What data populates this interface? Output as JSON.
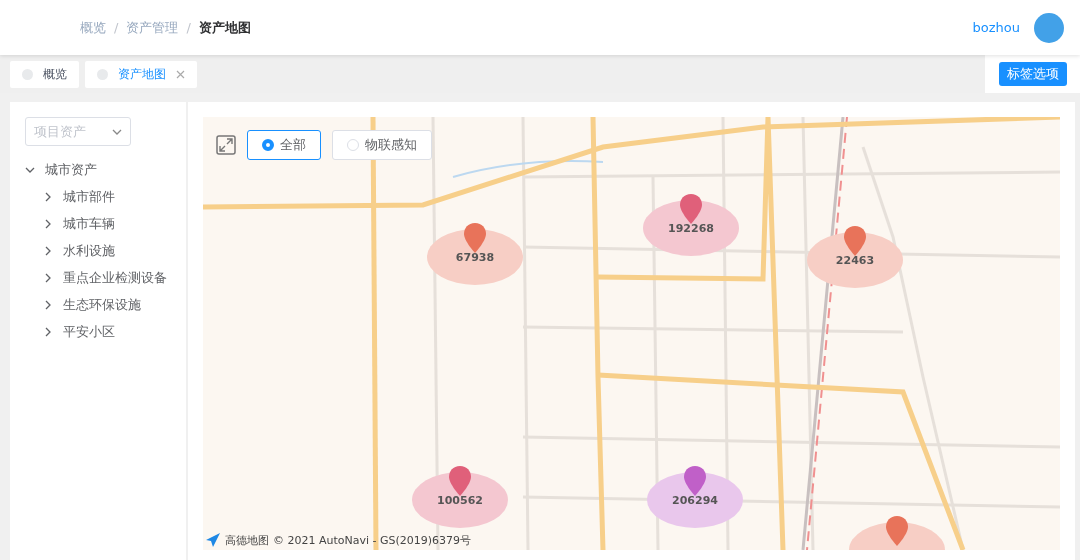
{
  "breadcrumb": {
    "separator": "/",
    "items": [
      {
        "label": "概览",
        "current": false
      },
      {
        "label": "资产管理",
        "current": false
      },
      {
        "label": "资产地图",
        "current": true
      }
    ]
  },
  "user": {
    "name": "bozhou"
  },
  "tabs": [
    {
      "label": "概览",
      "selected": false,
      "closable": false
    },
    {
      "label": "资产地图",
      "selected": true,
      "closable": true
    }
  ],
  "tab_options_button": "标签选项",
  "sidebar": {
    "select": {
      "placeholder": "项目资产"
    },
    "tree": [
      {
        "label": "城市资产",
        "expanded": true,
        "children": [
          {
            "label": "城市部件",
            "expanded": false
          },
          {
            "label": "城市车辆",
            "expanded": false
          },
          {
            "label": "水利设施",
            "expanded": false
          },
          {
            "label": "重点企业检测设备",
            "expanded": false
          },
          {
            "label": "生态环保设施",
            "expanded": false
          },
          {
            "label": "平安小区",
            "expanded": false
          }
        ]
      }
    ]
  },
  "map": {
    "filters": [
      {
        "label": "全部",
        "selected": true
      },
      {
        "label": "物联感知",
        "selected": false
      }
    ],
    "clusters": [
      {
        "count": "67938",
        "color": "#e8735a"
      },
      {
        "count": "192268",
        "color": "#e0607a"
      },
      {
        "count": "22463",
        "color": "#e8735a"
      },
      {
        "count": "100562",
        "color": "#e0607a"
      },
      {
        "count": "206294",
        "color": "#c060c8"
      },
      {
        "color": "#e8735a"
      }
    ],
    "logo_text": "高德地图",
    "attribution": "© 2021 AutoNavi - GS(2019)6379号"
  }
}
